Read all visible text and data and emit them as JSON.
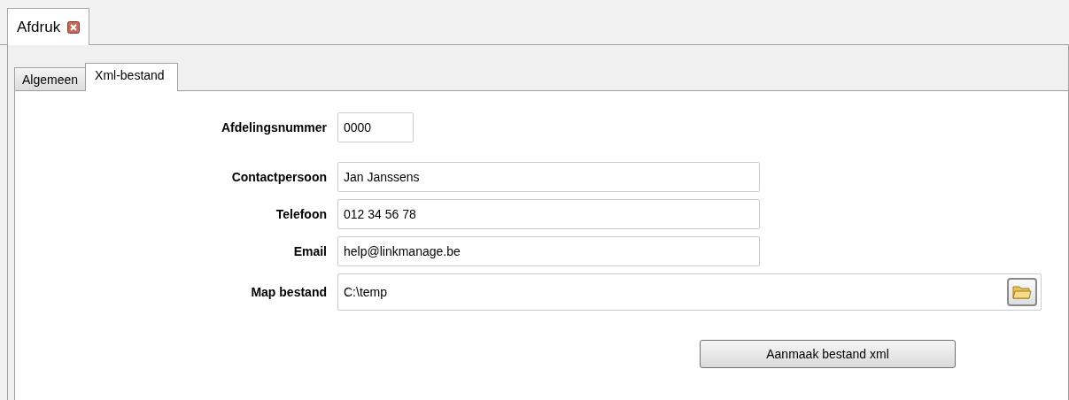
{
  "document_tabs": [
    {
      "label": "Afdruk",
      "selected": true,
      "closable": true
    }
  ],
  "tabs": [
    {
      "label": "Algemeen",
      "selected": false
    },
    {
      "label": "Xml-bestand",
      "selected": true
    }
  ],
  "form": {
    "fields": [
      {
        "label": "Afdelingsnummer",
        "value": "0000",
        "kind": "short"
      },
      {
        "label": "Contactpersoon",
        "value": "Jan Janssens",
        "kind": "medium"
      },
      {
        "label": "Telefoon",
        "value": "012 34 56 78",
        "kind": "medium"
      },
      {
        "label": "Email",
        "value": "help@linkmanage.be",
        "kind": "medium"
      },
      {
        "label": "Map bestand",
        "value": "C:\\temp",
        "kind": "folder"
      }
    ],
    "button": "Aanmaak bestand xml"
  }
}
